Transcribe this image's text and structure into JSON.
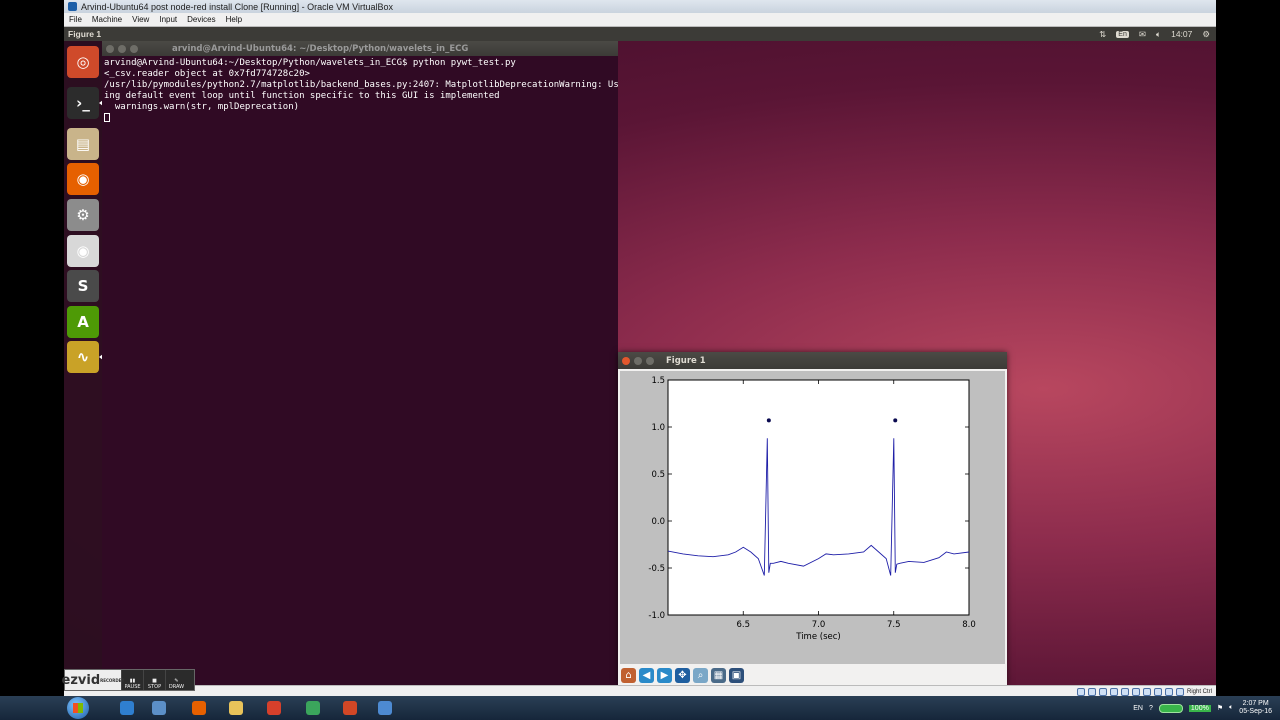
{
  "host": {
    "window_title": "Arvind-Ubuntu64 post node-red install Clone [Running] - Oracle VM VirtualBox",
    "menu": [
      "File",
      "Machine",
      "View",
      "Input",
      "Devices",
      "Help"
    ],
    "status_right": "Right Ctrl"
  },
  "guest": {
    "panel_title": "Figure 1",
    "keyboard": "En",
    "time": "14:07"
  },
  "launcher": [
    {
      "name": "dash-icon",
      "glyph": "◎",
      "color": "#cf4a2a"
    },
    {
      "name": "terminal-icon",
      "glyph": "›_",
      "color": "#2c2c2c"
    },
    {
      "name": "files-icon",
      "glyph": "▤",
      "color": "#c9b48a"
    },
    {
      "name": "firefox-icon",
      "glyph": "◉",
      "color": "#e66000"
    },
    {
      "name": "system-settings-icon",
      "glyph": "⚙",
      "color": "#8c8c8c"
    },
    {
      "name": "dvd-icon",
      "glyph": "◉",
      "color": "#d8d8d8"
    },
    {
      "name": "sublime-text-icon",
      "glyph": "S",
      "color": "#4a4a4a"
    },
    {
      "name": "software-updater-icon",
      "glyph": "A",
      "color": "#4e9a06"
    },
    {
      "name": "oscilloscope-icon",
      "glyph": "∿",
      "color": "#c9a227"
    }
  ],
  "terminal": {
    "title": "arvind@Arvind-Ubuntu64: ~/Desktop/Python/wavelets_in_ECG",
    "lines": [
      "arvind@Arvind-Ubuntu64:~/Desktop/Python/wavelets_in_ECG$ python pywt_test.py",
      "<_csv.reader object at 0x7fd774728c20>",
      "/usr/lib/pymodules/python2.7/matplotlib/backend_bases.py:2407: MatplotlibDeprecationWarning: Us",
      "ing default event loop until function specific to this GUI is implemented",
      "  warnings.warn(str, mplDeprecation)"
    ]
  },
  "figure": {
    "title": "Figure 1",
    "chart_data": {
      "type": "line",
      "xlabel": "Time (sec)",
      "ylabel": "",
      "xlim": [
        6.0,
        8.0
      ],
      "ylim": [
        -1.0,
        1.5
      ],
      "xticks": [
        "6.5",
        "7.0",
        "7.5",
        "8.0"
      ],
      "yticks": [
        "1.5",
        "1.0",
        "0.5",
        "0.0",
        "-0.5",
        "-1.0"
      ],
      "series": [
        {
          "x": [
            6.0,
            6.1,
            6.2,
            6.3,
            6.4,
            6.45,
            6.5,
            6.55,
            6.6,
            6.64,
            6.66,
            6.67,
            6.68,
            6.7,
            6.75,
            6.8,
            6.9,
            7.0,
            7.05,
            7.1,
            7.2,
            7.3,
            7.35,
            7.4,
            7.45,
            7.48,
            7.5,
            7.51,
            7.52,
            7.54,
            7.6,
            7.7,
            7.8,
            7.85,
            7.9,
            8.0
          ],
          "y": [
            -0.32,
            -0.35,
            -0.37,
            -0.38,
            -0.36,
            -0.33,
            -0.28,
            -0.33,
            -0.4,
            -0.58,
            0.88,
            -0.55,
            -0.45,
            -0.45,
            -0.43,
            -0.45,
            -0.48,
            -0.4,
            -0.35,
            -0.36,
            -0.35,
            -0.33,
            -0.26,
            -0.33,
            -0.4,
            -0.58,
            0.88,
            -0.55,
            -0.46,
            -0.45,
            -0.43,
            -0.44,
            -0.39,
            -0.33,
            -0.35,
            -0.33
          ]
        }
      ],
      "peaks": {
        "x": [
          6.67,
          7.51
        ],
        "y": [
          1.07,
          1.07
        ]
      }
    },
    "toolbar": [
      {
        "name": "home-icon",
        "glyph": "⌂",
        "color": "#c06030"
      },
      {
        "name": "back-icon",
        "glyph": "◀",
        "color": "#2a8ac9"
      },
      {
        "name": "forward-icon",
        "glyph": "▶",
        "color": "#2a8ac9"
      },
      {
        "name": "pan-icon",
        "glyph": "✥",
        "color": "#1f5fa0"
      },
      {
        "name": "zoom-icon",
        "glyph": "⌕",
        "color": "#7aa7c7"
      },
      {
        "name": "subplots-icon",
        "glyph": "▦",
        "color": "#4a6a88"
      },
      {
        "name": "save-icon",
        "glyph": "▣",
        "color": "#2d4f7a"
      }
    ]
  },
  "ezvid": {
    "logo": "ezvid",
    "sub": "RECORDER",
    "buttons": [
      "PAUSE",
      "STOP",
      "DRAW"
    ]
  },
  "taskbar": {
    "apps": [
      {
        "name": "ie-icon",
        "color": "#2f7fd0",
        "x": 113
      },
      {
        "name": "network-icon",
        "color": "#5c8fc7",
        "x": 145
      },
      {
        "name": "firefox-taskbar-icon",
        "color": "#e66000",
        "x": 185
      },
      {
        "name": "explorer-icon",
        "color": "#e8c35a",
        "x": 222
      },
      {
        "name": "vlc-icon",
        "color": "#d6402b",
        "x": 260
      },
      {
        "name": "chrome-icon",
        "color": "#3ba55c",
        "x": 299
      },
      {
        "name": "powerpoint-icon",
        "color": "#d24726",
        "x": 336
      },
      {
        "name": "virtualbox-icon",
        "color": "#4d8ad2",
        "x": 371
      }
    ],
    "language": "EN",
    "battery_percent": "100%",
    "clock_time": "2:07 PM",
    "clock_date": "05-Sep-16"
  }
}
